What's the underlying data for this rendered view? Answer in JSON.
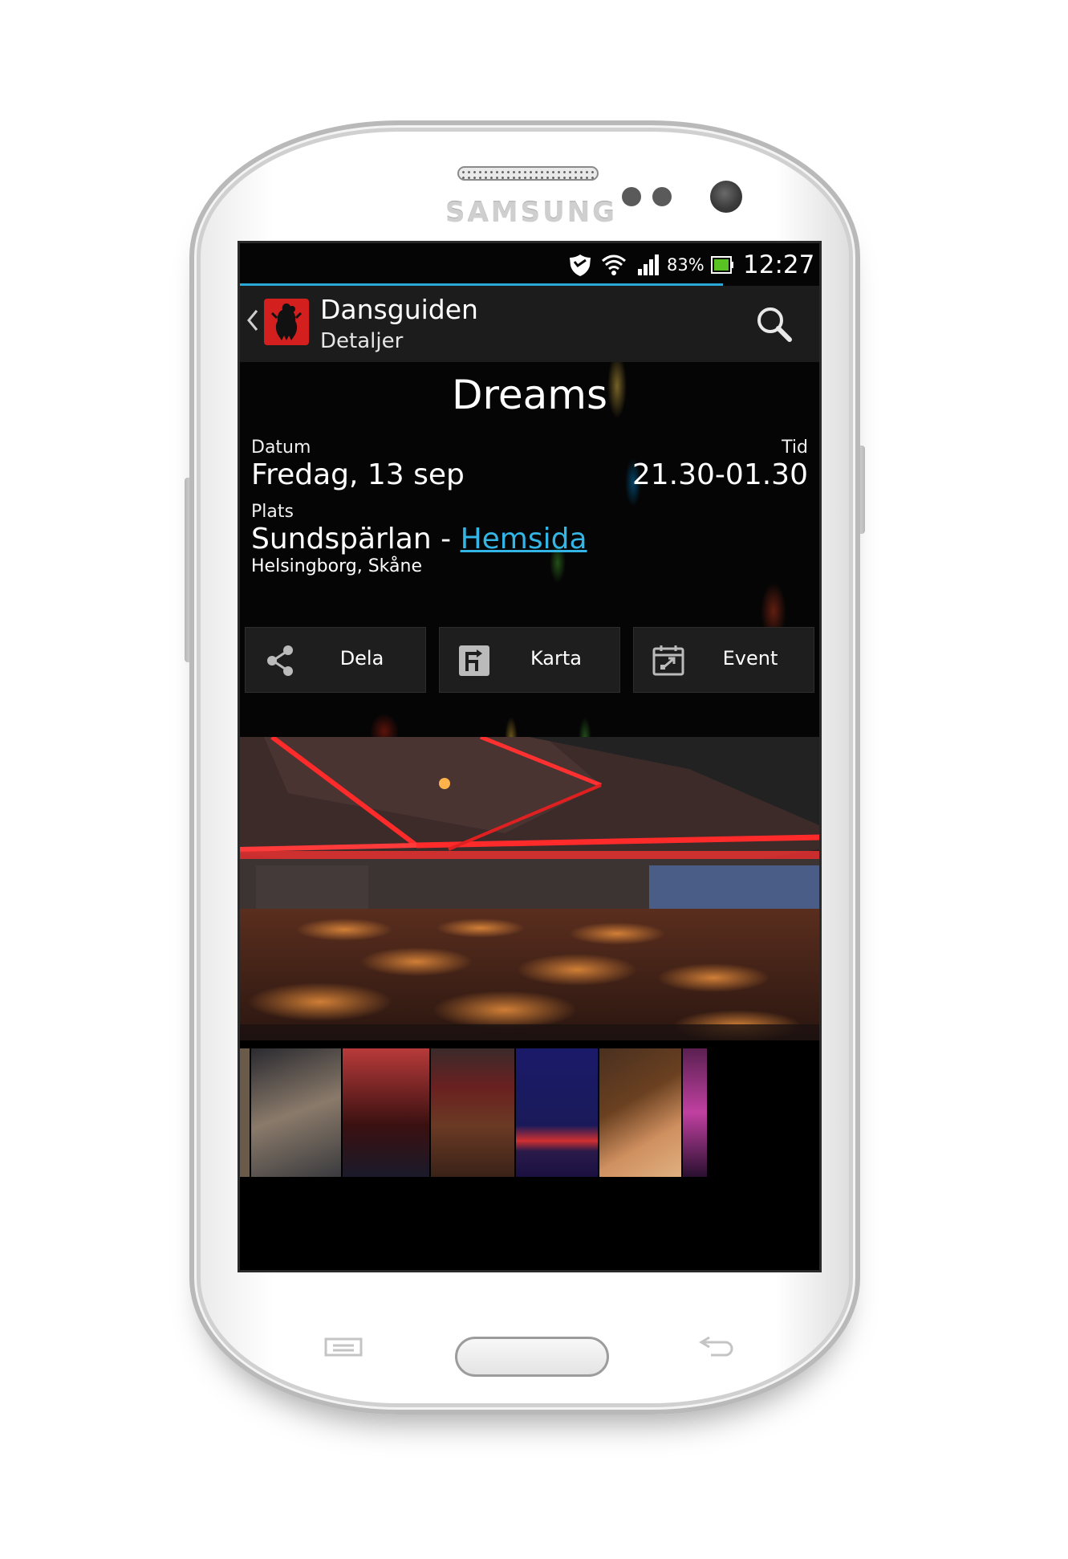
{
  "device": {
    "brand": "SAMSUNG"
  },
  "status_bar": {
    "battery_percent": "83%",
    "time": "12:27",
    "icons": [
      "shield-icon",
      "wifi-icon",
      "signal-icon",
      "battery-icon"
    ]
  },
  "action_bar": {
    "title": "Dansguiden",
    "subtitle": "Detaljer",
    "back_icon": "chevron-left-icon",
    "search_icon": "search-icon"
  },
  "event": {
    "name": "Dreams",
    "date_label": "Datum",
    "date_value": "Fredag, 13 sep",
    "time_label": "Tid",
    "time_value": "21.30-01.30",
    "place_label": "Plats",
    "place_name": "Sundspärlan",
    "place_separator": " - ",
    "place_link": "Hemsida",
    "place_address": "Helsingborg, Skåne"
  },
  "actions": [
    {
      "label": "Dela",
      "icon": "share-icon"
    },
    {
      "label": "Karta",
      "icon": "directions-icon"
    },
    {
      "label": "Event",
      "icon": "calendar-icon"
    }
  ],
  "colors": {
    "accent": "#33b5e5",
    "app_icon_red": "#d41f1f",
    "action_bar": "#1c1c1c"
  }
}
